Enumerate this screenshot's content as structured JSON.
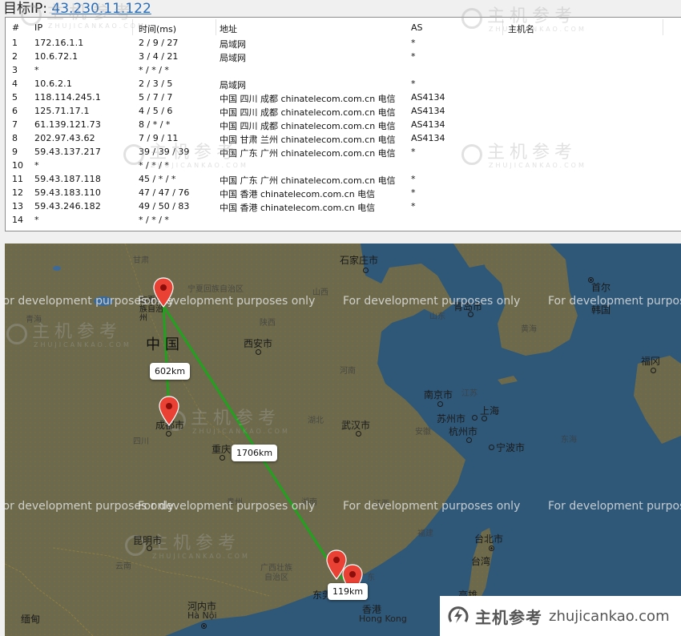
{
  "header": {
    "label": "目标IP:",
    "target_ip": "43.230.11.122"
  },
  "table": {
    "columns": [
      "#",
      "IP",
      "时间(ms)",
      "地址",
      "AS",
      "主机名"
    ],
    "rows": [
      {
        "num": "1",
        "ip": "172.16.1.1",
        "time": "2 / 9 / 27",
        "addr": "局域网",
        "as": "*",
        "host": ""
      },
      {
        "num": "2",
        "ip": "10.6.72.1",
        "time": "3 / 4 / 21",
        "addr": "局域网",
        "as": "*",
        "host": ""
      },
      {
        "num": "3",
        "ip": "*",
        "time": "* / * / *",
        "addr": "",
        "as": "",
        "host": ""
      },
      {
        "num": "4",
        "ip": "10.6.2.1",
        "time": "2 / 3 / 5",
        "addr": "局域网",
        "as": "*",
        "host": ""
      },
      {
        "num": "5",
        "ip": "118.114.245.1",
        "time": "5 / 7 / 7",
        "addr": "中国 四川 成都 chinatelecom.com.cn 电信",
        "as": "AS4134",
        "host": ""
      },
      {
        "num": "6",
        "ip": "125.71.17.1",
        "time": "4 / 5 / 6",
        "addr": "中国 四川 成都 chinatelecom.com.cn 电信",
        "as": "AS4134",
        "host": ""
      },
      {
        "num": "7",
        "ip": "61.139.121.73",
        "time": "8 / * / *",
        "addr": "中国 四川 成都 chinatelecom.com.cn 电信",
        "as": "AS4134",
        "host": ""
      },
      {
        "num": "8",
        "ip": "202.97.43.62",
        "time": "7 / 9 / 11",
        "addr": "中国 甘肃 兰州 chinatelecom.com.cn 电信",
        "as": "AS4134",
        "host": ""
      },
      {
        "num": "9",
        "ip": "59.43.137.217",
        "time": "39 / 39 / 39",
        "addr": "中国 广东 广州 chinatelecom.com.cn 电信",
        "as": "*",
        "host": ""
      },
      {
        "num": "10",
        "ip": "*",
        "time": "* / * / *",
        "addr": "",
        "as": "",
        "host": ""
      },
      {
        "num": "11",
        "ip": "59.43.187.118",
        "time": "45 / * / *",
        "addr": "中国 广东 广州 chinatelecom.com.cn 电信",
        "as": "*",
        "host": ""
      },
      {
        "num": "12",
        "ip": "59.43.183.110",
        "time": "47 / 47 / 76",
        "addr": "中国 香港 chinatelecom.com.cn 电信",
        "as": "*",
        "host": ""
      },
      {
        "num": "13",
        "ip": "59.43.246.182",
        "time": "49 / 50 / 83",
        "addr": "中国 香港 chinatelecom.com.cn 电信",
        "as": "*",
        "host": ""
      },
      {
        "num": "14",
        "ip": "*",
        "time": "* / * / *",
        "addr": "",
        "as": "",
        "host": ""
      }
    ]
  },
  "map": {
    "dev_notice": "For development purposes only",
    "country_label": "中国",
    "route_color": "#22a11f",
    "pin_color": "#e94235",
    "hops": [
      {
        "name": "兰州"
      },
      {
        "name": "成都"
      },
      {
        "name": "广州"
      },
      {
        "name": "香港"
      }
    ],
    "distances": [
      "602km",
      "1706km",
      "119km"
    ],
    "cities": [
      "石家庄市",
      "首尔",
      "韩国",
      "青岛市",
      "西安市",
      "福冈",
      "南京市",
      "上海",
      "苏州市",
      "杭州市",
      "武汉市",
      "成都市",
      "宁波市",
      "重庆",
      "台北市",
      "台湾",
      "昆明市",
      "东莞",
      "香港",
      "Hong Kong",
      "河内市",
      "Hà Nội",
      "缅甸",
      "高雄",
      "临夏回族自治州",
      "首尔 서울"
    ],
    "provinces": [
      "甘肃",
      "宁夏回族自治区",
      "山西",
      "山东",
      "陕西",
      "青海",
      "河南",
      "江苏",
      "湖北",
      "安徽",
      "四川",
      "贵州",
      "湖南",
      "江西",
      "浙江",
      "福建",
      "云南",
      "广西壮族自治区",
      "广东",
      "黄海",
      "东海"
    ]
  },
  "watermark": {
    "cn": "主机参考",
    "en": "ZHUJICANKAO.COM",
    "badge_cn": "主机参考",
    "badge_en": "zhujicankao.com"
  }
}
